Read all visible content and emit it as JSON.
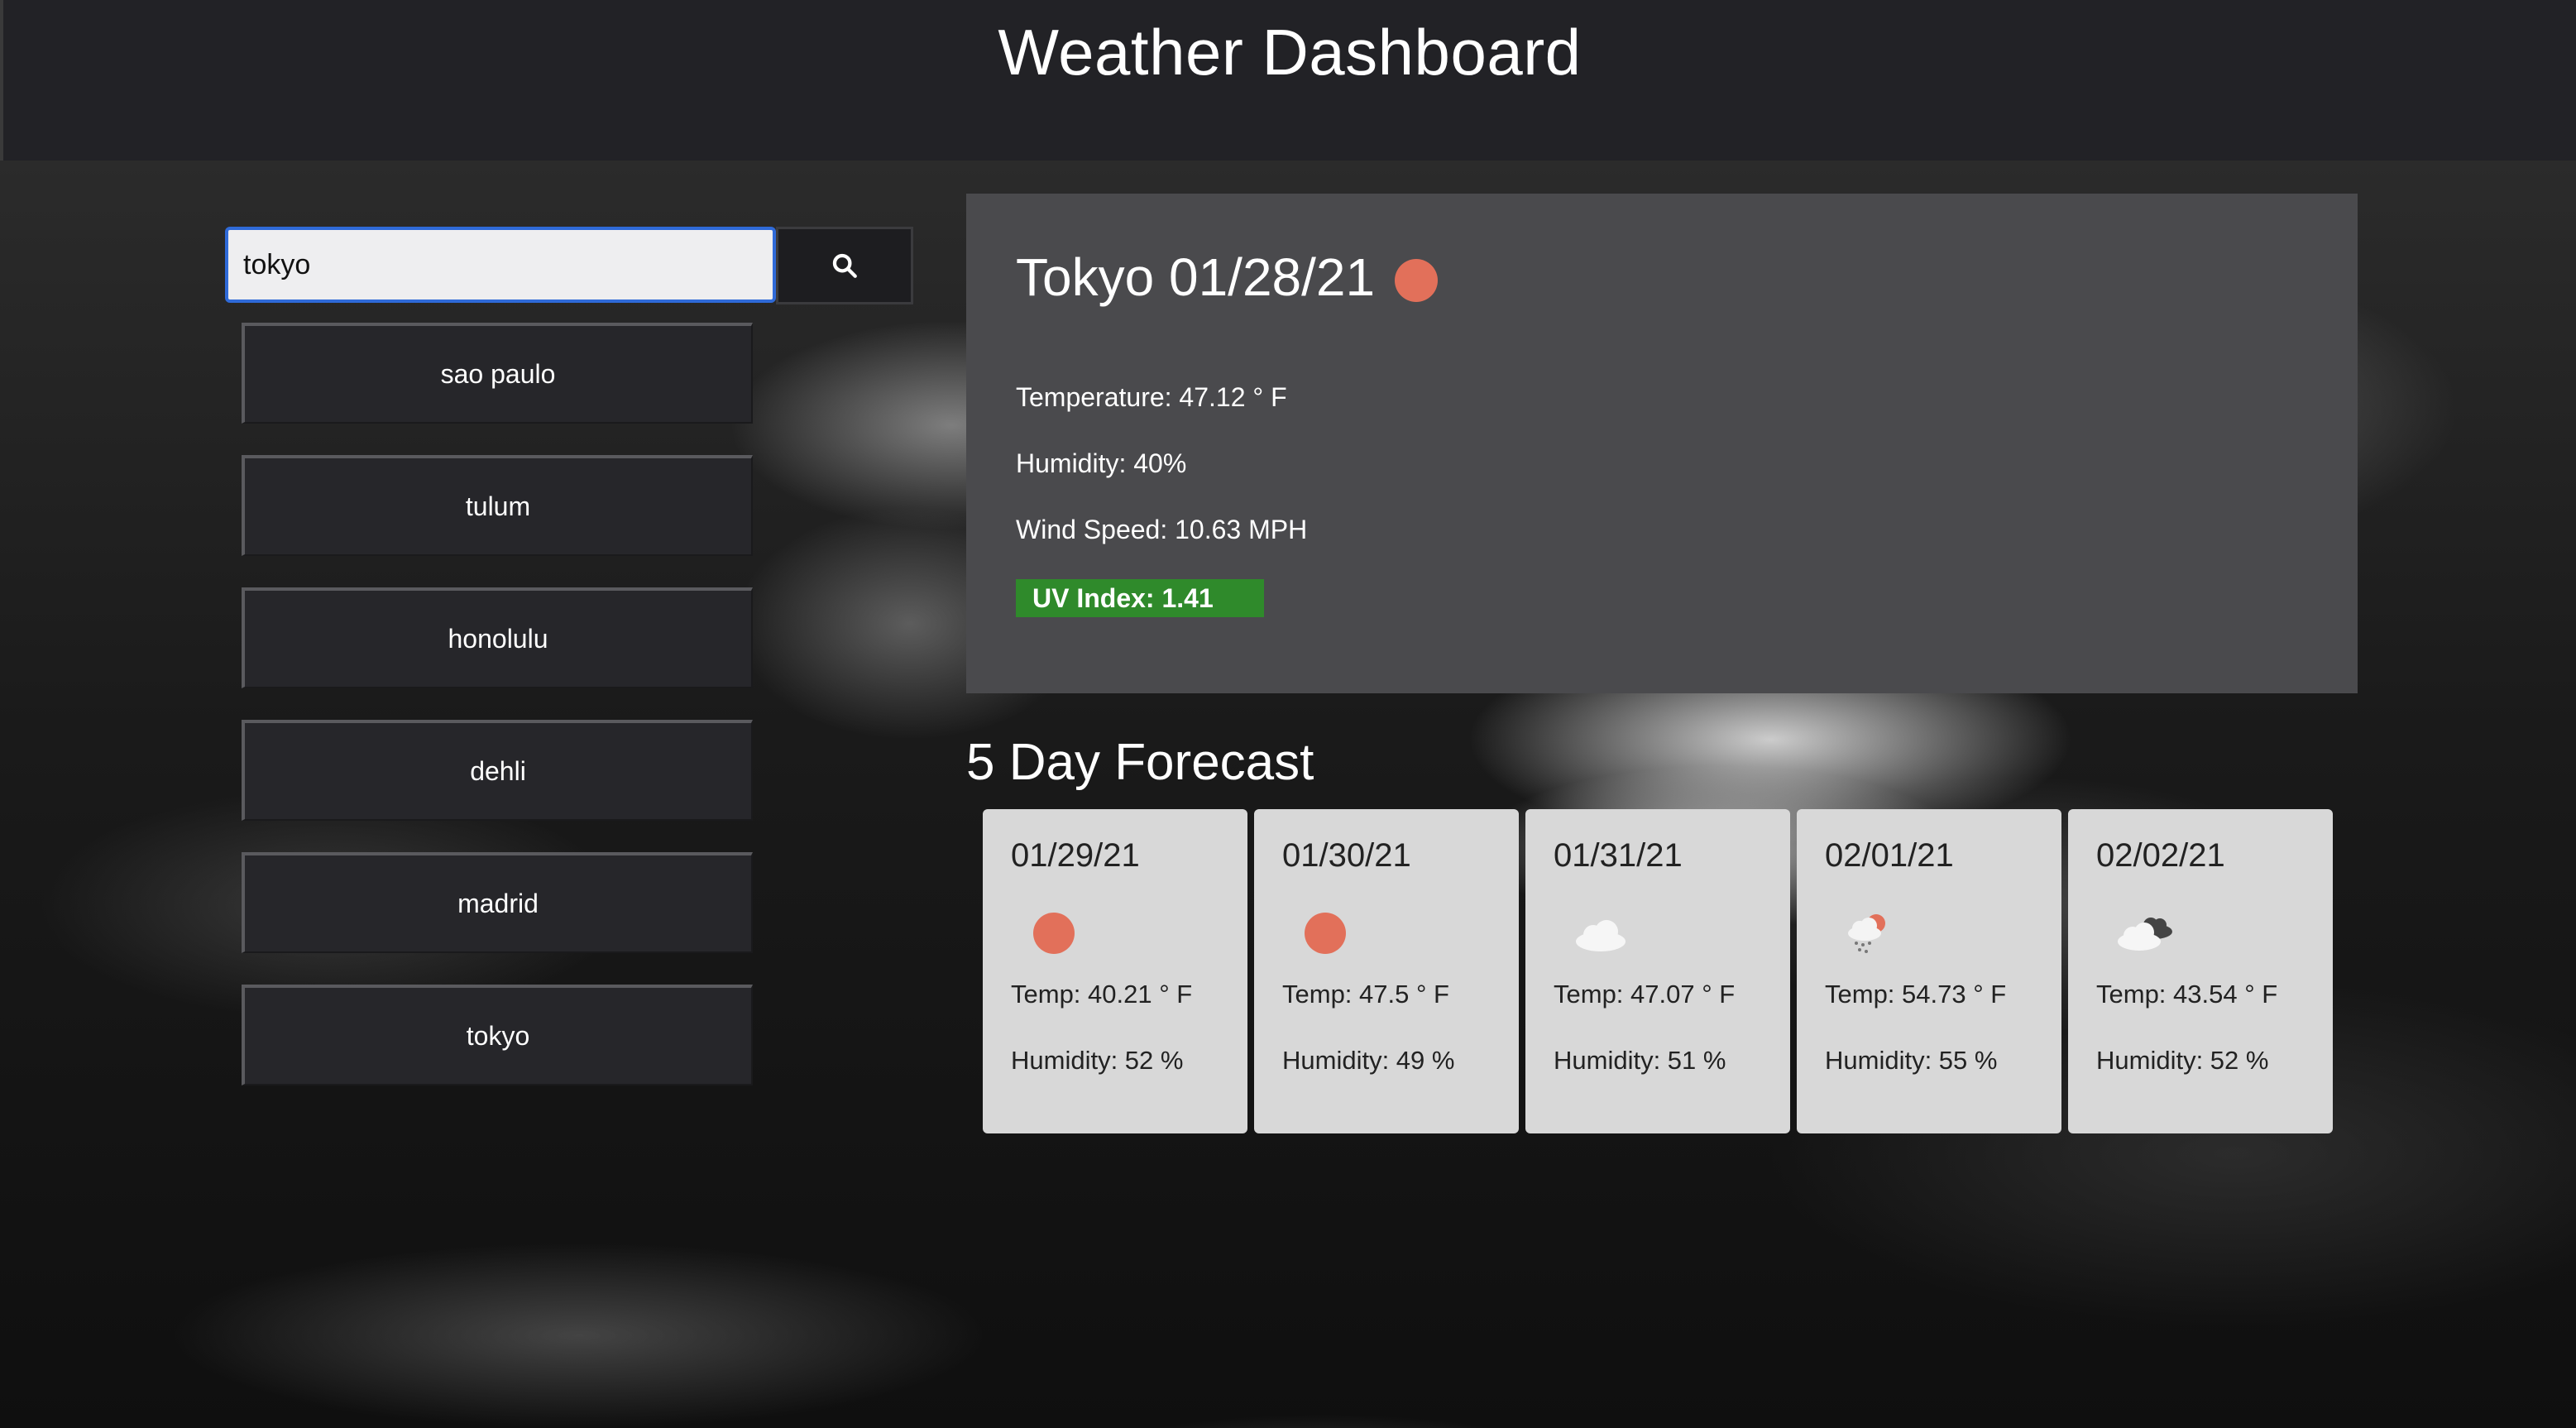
{
  "header": {
    "title": "Weather Dashboard"
  },
  "search": {
    "value": "tokyo",
    "button_icon": "search-icon"
  },
  "history": [
    {
      "label": "sao paulo"
    },
    {
      "label": "tulum"
    },
    {
      "label": "honolulu"
    },
    {
      "label": "dehli"
    },
    {
      "label": "madrid"
    },
    {
      "label": "tokyo"
    }
  ],
  "current": {
    "title": "Tokyo 01/28/21",
    "icon": "sun-icon",
    "temperature": "Temperature: 47.12 ° F",
    "humidity": "Humidity: 40%",
    "wind": "Wind Speed: 10.63 MPH",
    "uv": "UV Index: 1.41",
    "uv_color": "#2f8a2b"
  },
  "forecast": {
    "title": "5 Day Forecast",
    "days": [
      {
        "date": "01/29/21",
        "icon": "sun-icon",
        "temp": "Temp: 40.21 ° F",
        "humidity": "Humidity: 52 %"
      },
      {
        "date": "01/30/21",
        "icon": "sun-icon",
        "temp": "Temp: 47.5 ° F",
        "humidity": "Humidity: 49 %"
      },
      {
        "date": "01/31/21",
        "icon": "cloud-icon",
        "temp": "Temp: 47.07 ° F",
        "humidity": "Humidity: 51 %"
      },
      {
        "date": "02/01/21",
        "icon": "rain-sun-icon",
        "temp": "Temp: 54.73 ° F",
        "humidity": "Humidity: 55 %"
      },
      {
        "date": "02/02/21",
        "icon": "dark-clouds-icon",
        "temp": "Temp: 43.54 ° F",
        "humidity": "Humidity: 52 %"
      }
    ]
  },
  "colors": {
    "sun": "#e2705a",
    "uv_low": "#2f8a2b",
    "header_bg": "#222226",
    "card_bg": "#4a4a4d",
    "forecast_card_bg": "#d8d8d8"
  }
}
